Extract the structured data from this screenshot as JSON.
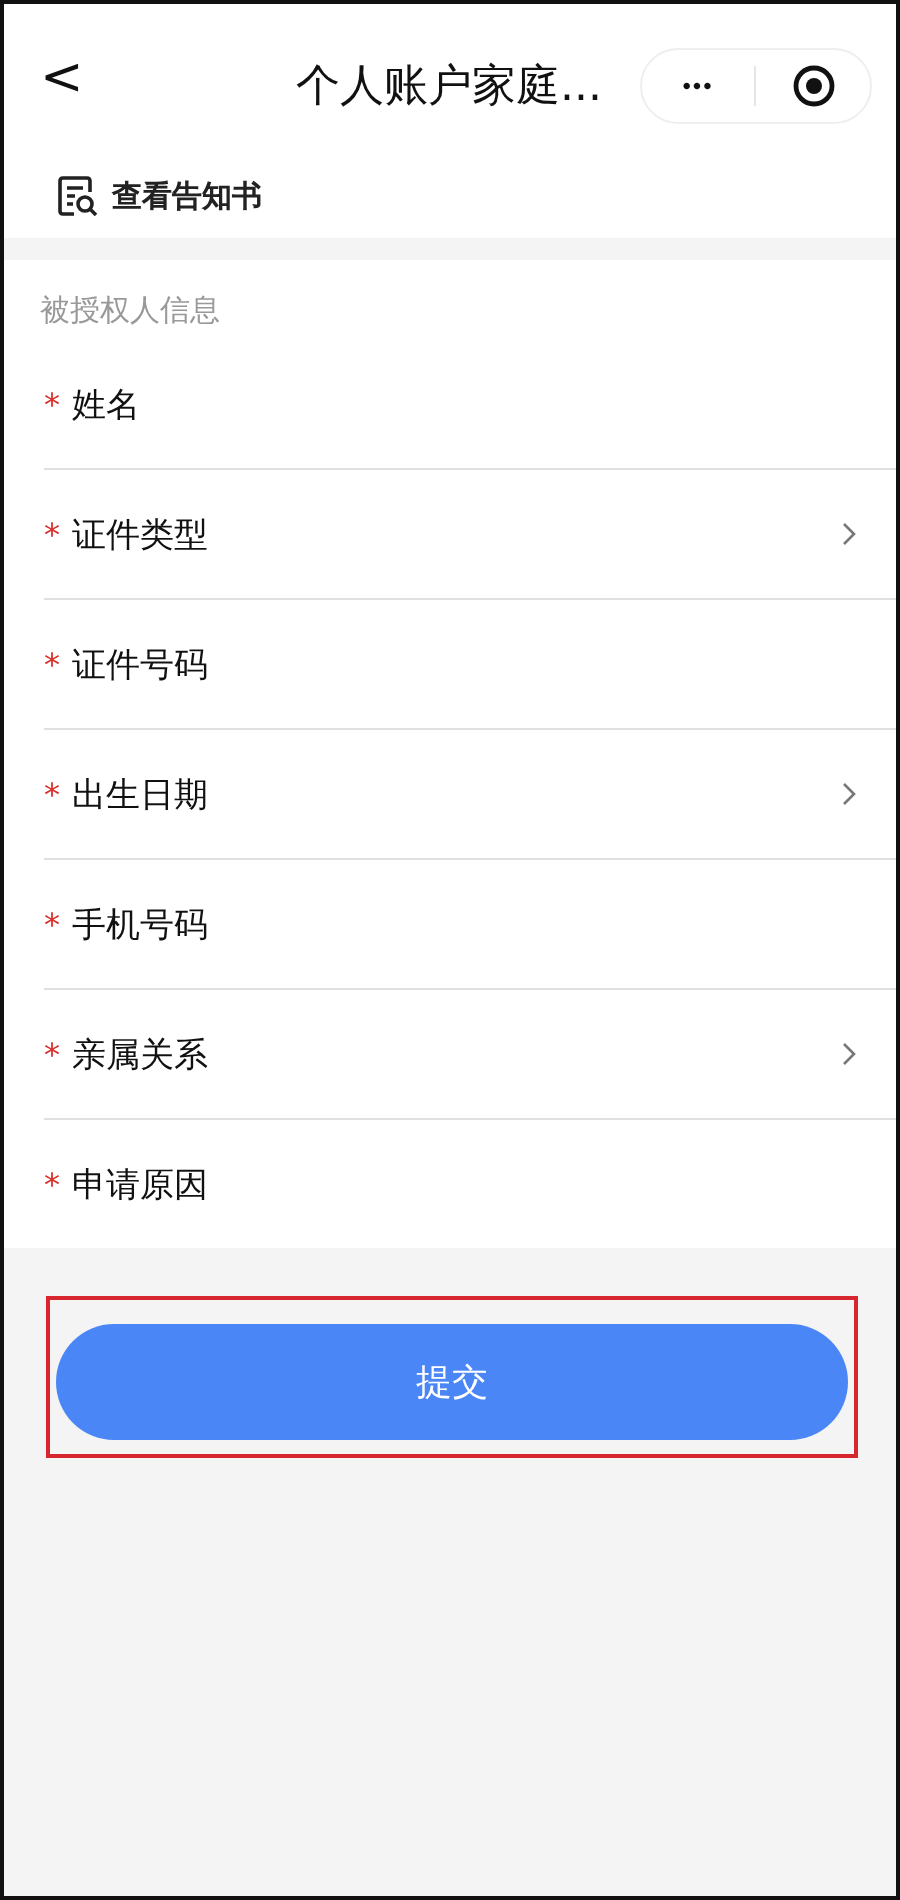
{
  "nav": {
    "back": "<",
    "title": "个人账户家庭...",
    "more": "•••"
  },
  "notice": {
    "label": "查看告知书"
  },
  "section": {
    "title": "被授权人信息"
  },
  "fields": [
    {
      "marker": "*",
      "label": "姓名",
      "kind": "input"
    },
    {
      "marker": "*",
      "label": "证件类型",
      "kind": "select"
    },
    {
      "marker": "*",
      "label": "证件号码",
      "kind": "input"
    },
    {
      "marker": "*",
      "label": "出生日期",
      "kind": "select"
    },
    {
      "marker": "*",
      "label": "手机号码",
      "kind": "input"
    },
    {
      "marker": "*",
      "label": "亲属关系",
      "kind": "select"
    },
    {
      "marker": "*",
      "label": "申请原因",
      "kind": "input"
    }
  ],
  "submit": {
    "label": "提交",
    "highlighted": true
  }
}
